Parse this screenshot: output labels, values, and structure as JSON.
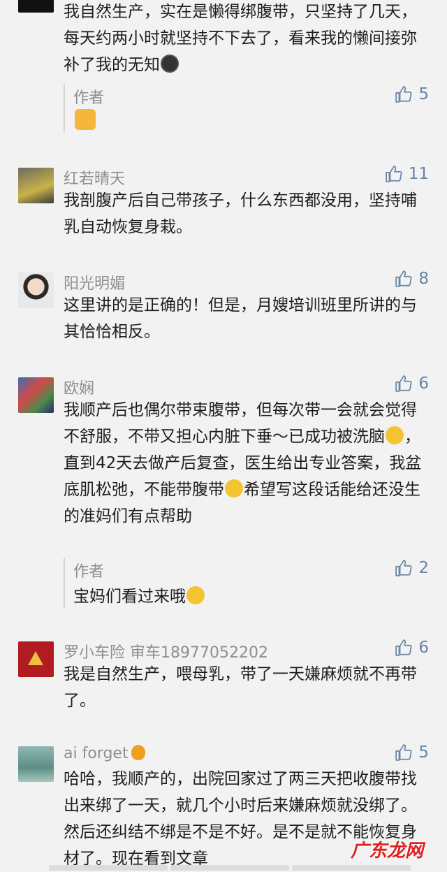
{
  "comment0": {
    "text": "我自然生产，实在是懒得绑腹带，只坚持了几天，每天约两小时就坚持不下去了，看来我的懒间接弥补了我的无知",
    "reply": {
      "author": "作者",
      "likes": "5"
    }
  },
  "comment1": {
    "name": "红若晴天",
    "likes": "11",
    "text": "我剖腹产后自己带孩子，什么东西都没用，坚持哺乳自动恢复身栽。"
  },
  "comment2": {
    "name": "阳光明媚",
    "likes": "8",
    "text": "这里讲的是正确的！但是，月嫂培训班里所讲的与其恰恰相反。"
  },
  "comment3": {
    "name": "欧娴",
    "likes": "6",
    "text_a": "我顺产后也偶尔带束腹带，但每次带一会就会觉得不舒服，不带又担心内脏下垂～已成功被洗脑",
    "text_b": "，直到42天去做产后复查，医生给出专业答案，我盆底肌松弛，不能带腹带",
    "text_c": "希望写这段话能给还没生的准妈们有点帮助",
    "reply": {
      "author": "作者",
      "text": "宝妈们看过来哦",
      "likes": "2"
    }
  },
  "comment4": {
    "name": "罗小车险 审车18977052202",
    "likes": "6",
    "text": "我是自然生产，喂母乳，带了一天嫌麻烦就不再带了。"
  },
  "comment5": {
    "name": "ai forget",
    "likes": "5",
    "text": "哈哈，我顺产的，出院回家过了两三天把收腹带找出来绑了一天，就几个小时后来嫌麻烦就没绑了。然后还纠结不绑是不是不好。是不是就不能恢复身材了。现在看到文章"
  },
  "watermark": "广东龙网",
  "colors": {
    "like": "#6b84a6",
    "name": "#8e8e8e",
    "watermark": "#e02020"
  }
}
